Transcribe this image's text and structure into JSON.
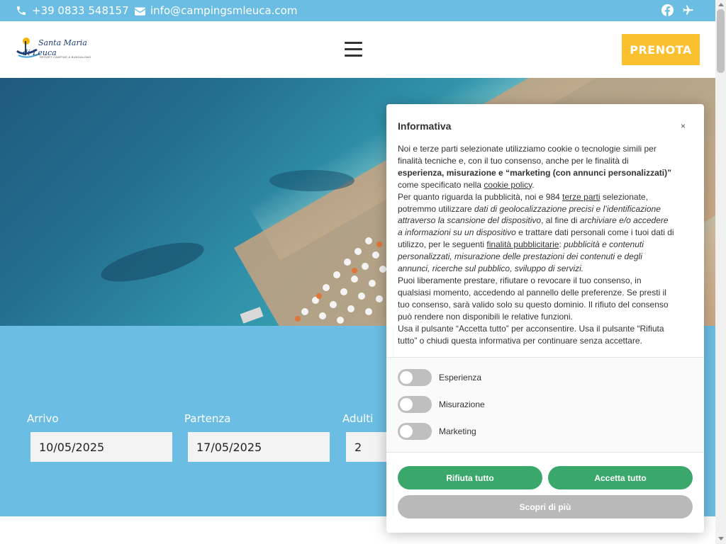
{
  "topbar": {
    "phone": "+39 0833 548157",
    "email": "info@campingsmleuca.com",
    "social_icons": [
      "facebook-icon",
      "tripadvisor-icon"
    ]
  },
  "header": {
    "logo_line1": "Santa Maria",
    "logo_line2": "di Leuca",
    "logo_line3": "RESORT CAMPING & BUNGALOWS",
    "menu_icon": "hamburger-menu-icon",
    "book_button": "PRENOTA"
  },
  "booking": {
    "arrival_label": "Arrivo",
    "arrival_value": "10/05/2025",
    "departure_label": "Partenza",
    "departure_value": "17/05/2025",
    "adults_label": "Adulti",
    "adults_value": "2"
  },
  "cookie_notice": {
    "title": "Informativa",
    "close": "×",
    "p1_a": "Noi e terze parti selezionate utilizziamo cookie o tecnologie simili per finalità tecniche e, con il tuo consenso, anche per le finalità di ",
    "p1_bold": "esperienza, misurazione e “marketing (con annunci personalizzati)”",
    "p1_b": " come specificato nella ",
    "p1_link": "cookie policy",
    "p1_c": ".",
    "p2_a": "Per quanto riguarda la pubblicità, noi e 984 ",
    "p2_link1": "terze parti",
    "p2_b": " selezionate, potremmo utilizzare ",
    "p2_italic1": "dati di geolocalizzazione precisi e l’identificazione attraverso la scansione del dispositivo",
    "p2_c": ", al fine di ",
    "p2_italic2": "archiviare e/o accedere a informazioni su un dispositivo",
    "p2_d": " e trattare dati personali come i tuoi dati di utilizzo, per le seguenti ",
    "p2_link2": "finalità pubblicitarie",
    "p2_e": ": ",
    "p2_italic3": "pubblicità e contenuti personalizzati, misurazione delle prestazioni dei contenuti e degli annunci, ricerche sul pubblico, sviluppo di servizi.",
    "p3": "Puoi liberamente prestare, rifiutare o revocare il tuo consenso, in qualsiasi momento, accedendo al pannello delle preferenze. Se presti il tuo consenso, sarà valido solo su questo dominio. Il rifiuto del consenso può rendere non disponibili le relative funzioni.",
    "p4": "Usa il pulsante “Accetta tutto” per acconsentire. Usa il pulsante “Rifiuta tutto” o chiudi questa informativa per continuare senza accettare.",
    "toggles": [
      {
        "label": "Esperienza",
        "on": false
      },
      {
        "label": "Misurazione",
        "on": false
      },
      {
        "label": "Marketing",
        "on": false
      }
    ],
    "reject_button": "Rifiuta tutto",
    "accept_button": "Accetta tutto",
    "more_button": "Scopri di più"
  },
  "colors": {
    "brand_blue": "#6bbde3",
    "book_yellow": "#fbc02d",
    "consent_green": "#3aa86b",
    "consent_grey": "#b9b9b9"
  }
}
